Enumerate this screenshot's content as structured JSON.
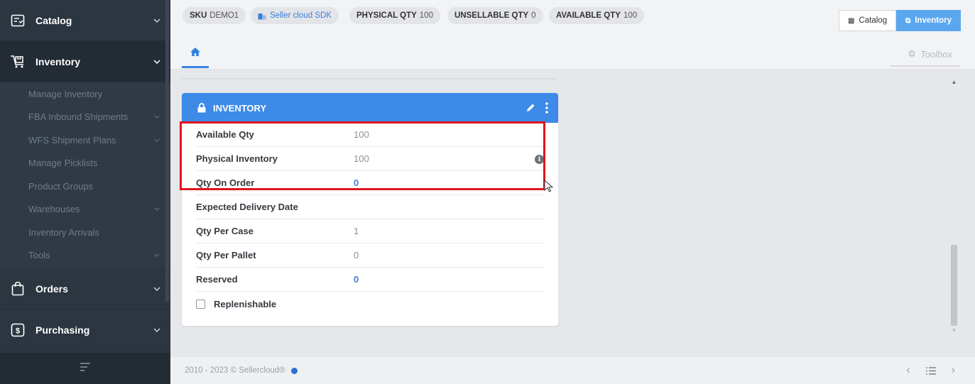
{
  "sidebar": {
    "sections": [
      {
        "label": "Catalog",
        "icon": "catalog-icon"
      },
      {
        "label": "Inventory",
        "icon": "inventory-cart-icon"
      },
      {
        "label": "Orders",
        "icon": "shopping-bag-icon"
      },
      {
        "label": "Purchasing",
        "icon": "dollar-icon"
      }
    ],
    "inventory_items": [
      {
        "label": "Manage Inventory",
        "has_chevron": false
      },
      {
        "label": "FBA Inbound Shipments",
        "has_chevron": true
      },
      {
        "label": "WFS Shipment Plans",
        "has_chevron": true
      },
      {
        "label": "Manage Picklists",
        "has_chevron": false
      },
      {
        "label": "Product Groups",
        "has_chevron": false
      },
      {
        "label": "Warehouses",
        "has_chevron": true
      },
      {
        "label": "Inventory Arrivals",
        "has_chevron": false
      },
      {
        "label": "Tools",
        "has_chevron": true
      }
    ]
  },
  "topbar": {
    "sku_label": "SKU",
    "sku_value": "DEMO1",
    "company_label": "Seller cloud SDK",
    "physical_label": "PHYSICAL QTY",
    "physical_value": "100",
    "unsellable_label": "UNSELLABLE QTY",
    "unsellable_value": "0",
    "available_label": "AVAILABLE QTY",
    "available_value": "100",
    "catalog_button": "Catalog",
    "inventory_button": "Inventory"
  },
  "tabs": {
    "toolbox_label": "Toolbox"
  },
  "card": {
    "title": "INVENTORY",
    "rows": [
      {
        "label": "Available Qty",
        "value": "100"
      },
      {
        "label": "Physical Inventory",
        "value": "100"
      },
      {
        "label": "Qty On Order",
        "value": "0"
      },
      {
        "label": "Expected Delivery Date",
        "value": ""
      },
      {
        "label": "Qty Per Case",
        "value": "1"
      },
      {
        "label": "Qty Per Pallet",
        "value": "0"
      },
      {
        "label": "Reserved",
        "value": "0"
      }
    ],
    "checkbox_label": "Replenishable",
    "checkbox_checked": false
  },
  "footer": {
    "copyright": "2010 - 2023 © Sellercloud®"
  },
  "colors": {
    "accent": "#3d8ae8",
    "sidebar_bg": "#2c3640",
    "highlight_red": "#e0141e"
  }
}
